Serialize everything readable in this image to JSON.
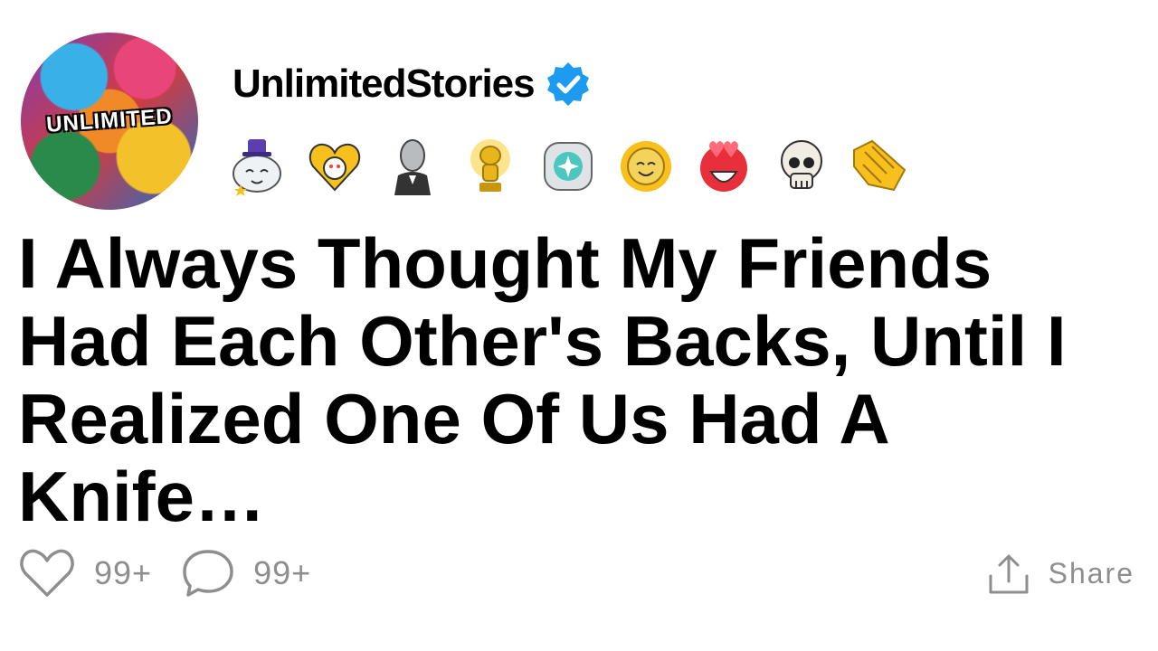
{
  "avatar": {
    "text": "UNLIMITED"
  },
  "user": {
    "name": "UnlimitedStories",
    "verified_icon": "verified-check-icon"
  },
  "awards": [
    "wholesome-award-icon",
    "heart-award-icon",
    "gentleman-award-icon",
    "gold-trophy-award-icon",
    "platinum-award-icon",
    "sun-smile-award-icon",
    "heart-eyes-award-icon",
    "skull-award-icon",
    "handshake-award-icon"
  ],
  "post": {
    "title": "I Always Thought My Friends Had Each Other's Backs, Until I Realized One Of Us Had A Knife…"
  },
  "actions": {
    "likes": "99+",
    "comments": "99+",
    "share": "Share"
  },
  "colors": {
    "verified": "#1d9bf0",
    "muted": "#8e8e8e"
  }
}
